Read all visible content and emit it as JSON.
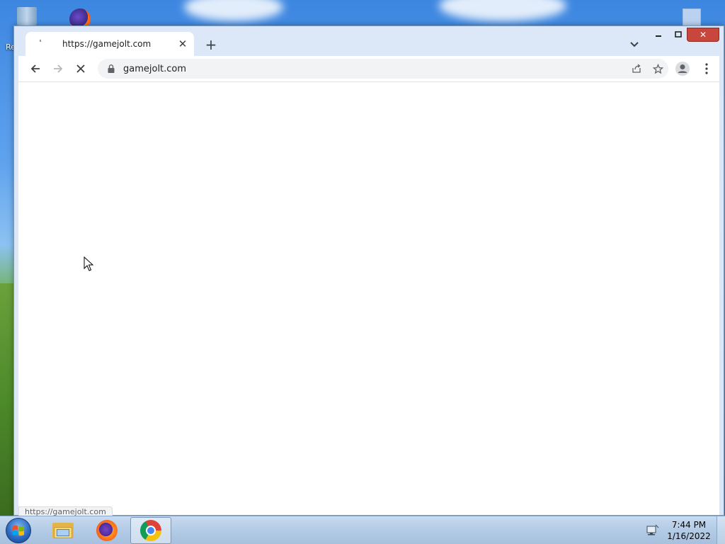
{
  "desktop": {
    "icons": [
      "recycle-bin",
      "firefox",
      "document"
    ],
    "partial_label": "Re"
  },
  "browser": {
    "tab": {
      "title": "https://gamejolt.com",
      "close_glyph": "✕"
    },
    "new_tab_glyph": "+",
    "window_controls": {
      "minimize": "▁",
      "maximize": "☐",
      "close": "✕"
    },
    "toolbar": {
      "url": "gamejolt.com",
      "loading": true
    },
    "status_bubble": "https://gamejolt.com"
  },
  "taskbar": {
    "apps": [
      {
        "name": "Windows Explorer",
        "icon": "folder-icon",
        "active": false
      },
      {
        "name": "Firefox",
        "icon": "firefox-icon",
        "active": false
      },
      {
        "name": "Google Chrome",
        "icon": "chrome-icon",
        "active": true
      }
    ],
    "clock": {
      "time": "7:44 PM",
      "date": "1/16/2022"
    }
  },
  "colors": {
    "close_button": "#c9463d",
    "taskbar": "#b3cbe6",
    "tabstrip": "#dce8f7"
  }
}
